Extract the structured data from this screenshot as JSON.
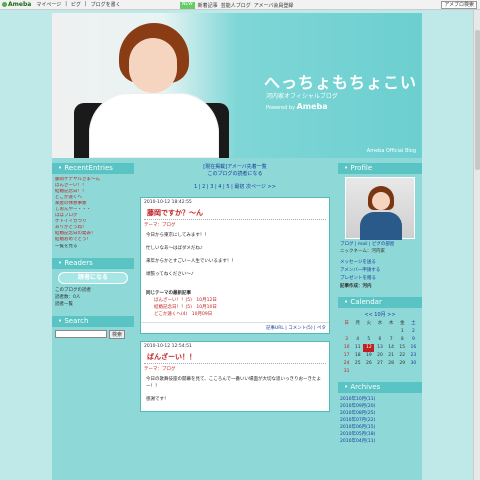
{
  "topbar": {
    "logo": "Ameba",
    "nav": [
      "マイページ",
      "ピグ",
      "ブログを書く"
    ],
    "badge": "NEW",
    "mid_links": [
      "新着記事",
      "芸能人ブログ",
      "アメーバ会員登録"
    ],
    "search_label": "アメブロ検索"
  },
  "header": {
    "title": "へっちょもちょこい",
    "subtitle": "河内家オフィシャルブログ",
    "powered": "Powered by",
    "powered_brand": "Ameba",
    "official": "Ameba Official Blog"
  },
  "left": {
    "recent_title": "RecentEntries",
    "entries": [
      "藤岡ケナヤルさま〜ん",
      "ばんざーい！！",
      "結婚記念日！！",
      "どこか遠くへ",
      "楽屋の休憩事象",
      "しおんやー・・・",
      "ほぼブログ",
      "ケトイイガつり",
      "ありがとうね！",
      "結婚記念日の発表！",
      "結婚おめでとう！"
    ],
    "entries_more": "一覧を見る",
    "readers_title": "Readers",
    "reader_button": "読者になる",
    "reader_lines": [
      "このブログの読者",
      "読者数：0人",
      "読者一覧"
    ],
    "search_title": "Search",
    "search_button": "検索"
  },
  "center": {
    "links": [
      "[現在掲載]アメーバ先着一覧",
      "このブログの読者になる"
    ],
    "pager": [
      "1",
      "2",
      "3",
      "4",
      "5",
      "最初",
      "次ページ >>"
    ],
    "posts": [
      {
        "date": "2010-10-12 18:42:55",
        "title": "藤岡ですか？〜ん",
        "theme": "テーマ：ブログ",
        "body": [
          "今日から東京にしてみます！！",
          "忙しいなあ〜はばダメだね♪",
          "来年からかとすごいー人生でいいるます！！",
          "頑張ってねください〜♪"
        ],
        "recent_heading": "同じテーマの最新記事",
        "recent": [
          "ばんざーい！！(5)　10月12日",
          "結婚記念日！！(5)　10月10日",
          "どこか遠くへ(4)　10月09日"
        ],
        "footer": "記事URL | コメント(5) | ペタ"
      },
      {
        "date": "2010-10-12 12:54:51",
        "title": "ばんざーい！！",
        "theme": "テーマ：ブログ",
        "body": [
          "今日の歌舞伎座の開幕を見て、こころんで一番いい場面が大切な思いっきりおーきたよー！！",
          "感謝です！"
        ]
      }
    ]
  },
  "right": {
    "profile_title": "Profile",
    "profile_links": [
      "ブログ",
      "mail",
      "ピグの部屋"
    ],
    "nickname": "ニックネーム：河内家",
    "actions": [
      "メッセージを送る",
      "アメンバー申請する",
      "プレゼントを贈る"
    ],
    "action_bold": "記事作成：河内",
    "calendar_title": "Calendar",
    "calendar_nav": "<< 10月 >>",
    "calendar_days": [
      "日",
      "月",
      "火",
      "水",
      "木",
      "金",
      "土"
    ],
    "calendar_cells": [
      "",
      "",
      "",
      "",
      "",
      "1",
      "2",
      "3",
      "4",
      "5",
      "6",
      "7",
      "8",
      "9",
      "10",
      "11",
      "12",
      "13",
      "14",
      "15",
      "16",
      "17",
      "18",
      "19",
      "20",
      "21",
      "22",
      "23",
      "24",
      "25",
      "26",
      "27",
      "28",
      "29",
      "30",
      "31",
      "",
      "",
      "",
      "",
      "",
      ""
    ],
    "archives_title": "Archives",
    "archives": [
      "2010年10月(11)",
      "2010年09月(20)",
      "2010年08月(25)",
      "2010年07月(22)",
      "2010年06月(15)",
      "2010年05月(18)",
      "2010年04月(11)"
    ]
  },
  "colors": {
    "accent": "#5ac3c3",
    "page_bg": "#8fd8d8",
    "link": "#1a3a9a",
    "entry": "#c02020"
  }
}
